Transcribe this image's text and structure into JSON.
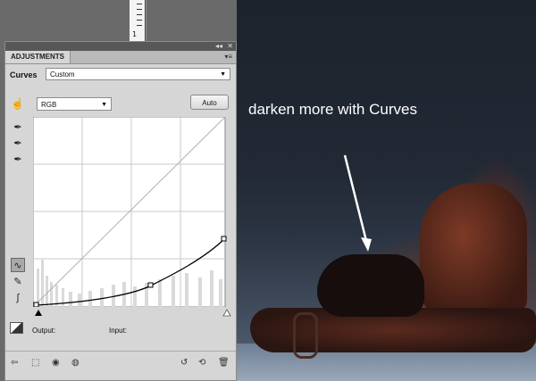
{
  "panel": {
    "tab": "ADJUSTMENTS",
    "preset_label": "Curves",
    "preset_value": "Custom",
    "channel_value": "RGB",
    "auto_label": "Auto",
    "output_label": "Output:",
    "input_label": "Input:"
  },
  "ruler": {
    "number": "1"
  },
  "photo": {
    "annotation": "darken more with Curves"
  },
  "colors": {
    "panel_bg": "#d6d6d6",
    "graph_bg": "#ffffff",
    "curve": "#000000"
  }
}
